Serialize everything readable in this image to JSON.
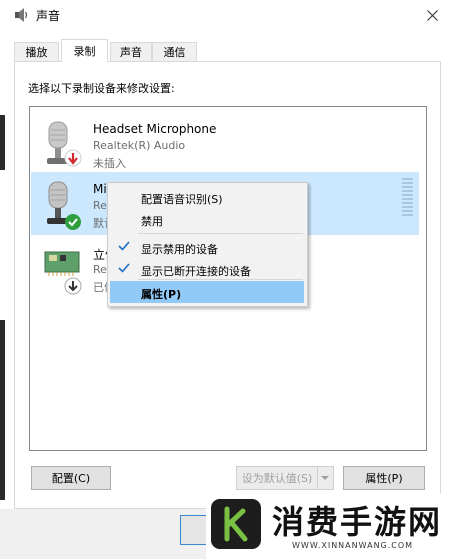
{
  "window": {
    "title": "声音",
    "close_glyph": "✕"
  },
  "tabs": [
    {
      "label": "播放",
      "active": false
    },
    {
      "label": "录制",
      "active": true
    },
    {
      "label": "声音",
      "active": false
    },
    {
      "label": "通信",
      "active": false
    }
  ],
  "instruction": "选择以下录制设备来修改设置:",
  "devices": [
    {
      "name": "Headset Microphone",
      "driver": "Realtek(R) Audio",
      "status": "未插入",
      "icon": "headset-microphone-icon",
      "badge": "unplugged-red-arrow"
    },
    {
      "name": "Mi",
      "driver": "Re",
      "status": "默认",
      "icon": "microphone-icon",
      "badge": "default-green-check",
      "selected": true
    },
    {
      "name": "立体",
      "driver": "Re",
      "status": "已停",
      "icon": "sound-card-icon",
      "badge": "disabled-down-arrow"
    }
  ],
  "context_menu": [
    {
      "label": "配置语音识别(S)",
      "checked": false,
      "highlighted": false
    },
    {
      "label": "禁用",
      "checked": false,
      "highlighted": false
    },
    {
      "label": "显示禁用的设备",
      "checked": true,
      "highlighted": false
    },
    {
      "label": "显示已断开连接的设备",
      "checked": true,
      "highlighted": false
    },
    {
      "label": "属性(P)",
      "checked": false,
      "highlighted": true,
      "bold": true
    }
  ],
  "buttons": {
    "configure": "配置(C)",
    "set_default": "设为默认值(S)",
    "properties": "属性(P)"
  },
  "watermark": {
    "text": "消费手游网",
    "url": "WWW.XINNANWANG.COM"
  },
  "colors": {
    "selection": "#cce8ff",
    "menu_highlight": "#91c9f7",
    "check_green": "#2f9e3f",
    "unplugged_red": "#d0282e"
  }
}
